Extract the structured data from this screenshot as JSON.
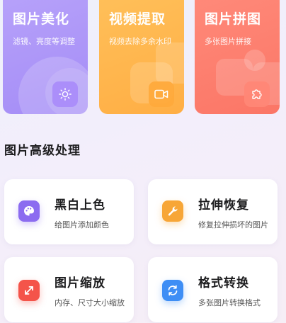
{
  "top_cards": [
    {
      "title": "图片美化",
      "subtitle": "滤镜、亮度等调整",
      "icon": "sun-brightness-icon"
    },
    {
      "title": "视频提取",
      "subtitle": "视频去除多余水印",
      "icon": "video-camera-icon"
    },
    {
      "title": "图片拼图",
      "subtitle": "多张图片拼接",
      "icon": "puzzle-piece-icon"
    }
  ],
  "section": {
    "title": "图片高级处理"
  },
  "tools": [
    {
      "title": "黑白上色",
      "subtitle": "给图片添加颜色",
      "icon": "palette-icon",
      "color": "#8c6cf0"
    },
    {
      "title": "拉伸恢复",
      "subtitle": "修复拉伸损坏的图片",
      "icon": "wrench-icon",
      "color": "#f7a637"
    },
    {
      "title": "图片缩放",
      "subtitle": "内存、尺寸大小缩放",
      "icon": "resize-arrows-icon",
      "color": "#f4544a"
    },
    {
      "title": "格式转换",
      "subtitle": "多张图片转换格式",
      "icon": "convert-refresh-icon",
      "color": "#3e8ef5"
    }
  ]
}
